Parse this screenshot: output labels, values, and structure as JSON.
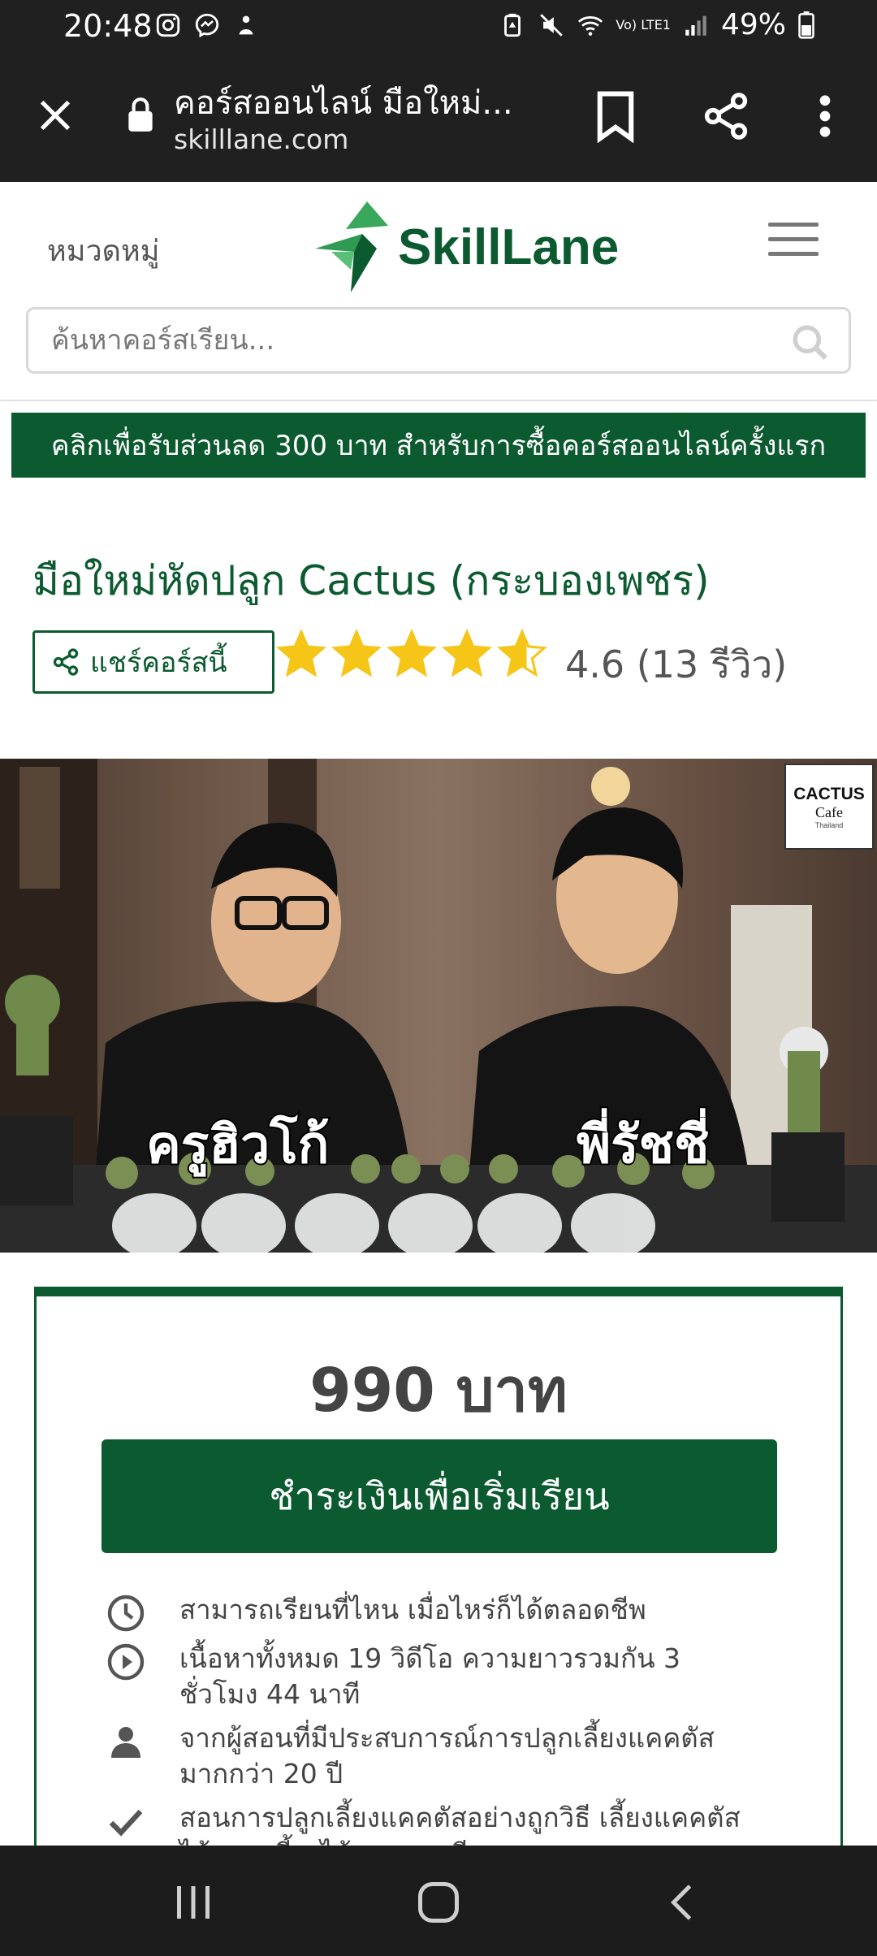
{
  "status_bar": {
    "time": "20:48",
    "battery": "49%",
    "network": "Vo) LTE1"
  },
  "browser": {
    "page_title": "คอร์สออนไลน์ มือใหม่...",
    "domain": "skilllane.com"
  },
  "header": {
    "category_label": "หมวดหมู่",
    "logo_text": "SkillLane",
    "search_placeholder": "ค้นหาคอร์สเรียน..."
  },
  "promo": {
    "text": "คลิกเพื่อรับส่วนลด 300 บาท สำหรับการซื้อคอร์สออนไลน์ครั้งแรก"
  },
  "course": {
    "title": "มือใหม่หัดปลูก  Cactus  (กระบองเพชร)",
    "share_label": "แชร์คอร์สนี้",
    "rating": 4.6,
    "rating_text": "4.6  (13  รีวิว)"
  },
  "hero": {
    "name_left": "ครูฮิวโก้",
    "name_right": "พี่รัชชี่",
    "logo_line1": "CACTUS",
    "logo_line2": "Cafe",
    "logo_line3": "Thailand"
  },
  "price_card": {
    "price": "990  บาท",
    "enroll_label": "ชำระเงินเพื่อเริ่มเรียน",
    "features": [
      {
        "icon": "clock-icon",
        "text": "สามารถเรียนที่ไหน  เมื่อไหร่ก็ได้ตลอดชีพ"
      },
      {
        "icon": "play-icon",
        "text": "เนื้อหาทั้งหมด  19  วิดีโอ  ความยาวรวมกัน  3  ชั่วโมง  44  นาที"
      },
      {
        "icon": "user-icon",
        "text": "จากผู้สอนที่มีประสบการณ์การปลูกเลี้ยงแคคตัส มากกว่า  20  ปี"
      },
      {
        "icon": "check-icon",
        "text": "สอนการปลูกเลี้ยงแคคตัสอย่างถูกวิธี  เลี้ยงแคคตัส ได้สวย  เลี้ยงได้สนุกและมีความสุข"
      }
    ]
  },
  "colors": {
    "brand_green": "#0b5a30",
    "star": "#f5c518",
    "dark_bar": "#202020"
  }
}
